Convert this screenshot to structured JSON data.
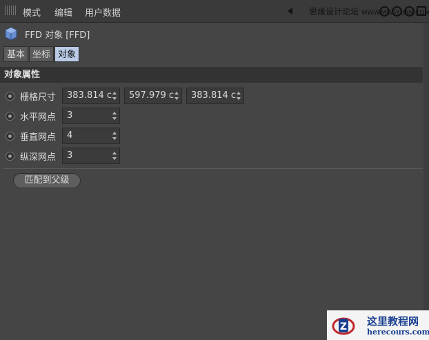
{
  "menubar": {
    "items": [
      "模式",
      "编辑",
      "用户数据"
    ],
    "watermark": "思缘设计论坛",
    "watermark_url": "WWW.MISSYUAN.COM"
  },
  "object": {
    "title": "FFD 对象 [FFD]",
    "icon": "ffd-cube-icon"
  },
  "tabs": [
    {
      "label": "基本",
      "active": false
    },
    {
      "label": "坐标",
      "active": false
    },
    {
      "label": "对象",
      "active": true
    }
  ],
  "section": {
    "title": "对象属性"
  },
  "properties": {
    "grid_size": {
      "label": "栅格尺寸",
      "x": "383.814 c",
      "y": "597.979 c",
      "z": "383.814 c"
    },
    "horizontal_points": {
      "label": "水平网点",
      "value": "3"
    },
    "vertical_points": {
      "label": "垂直网点",
      "value": "4"
    },
    "depth_points": {
      "label": "纵深网点",
      "value": "3"
    }
  },
  "buttons": {
    "match_parent": "匹配到父级"
  },
  "watermark_logo": {
    "line1": "这里教程网",
    "line2": "herecours.com"
  },
  "colors": {
    "panel": "#454545",
    "active_tab": "#b9cbe6",
    "logo_blue": "#1a3f8f"
  }
}
